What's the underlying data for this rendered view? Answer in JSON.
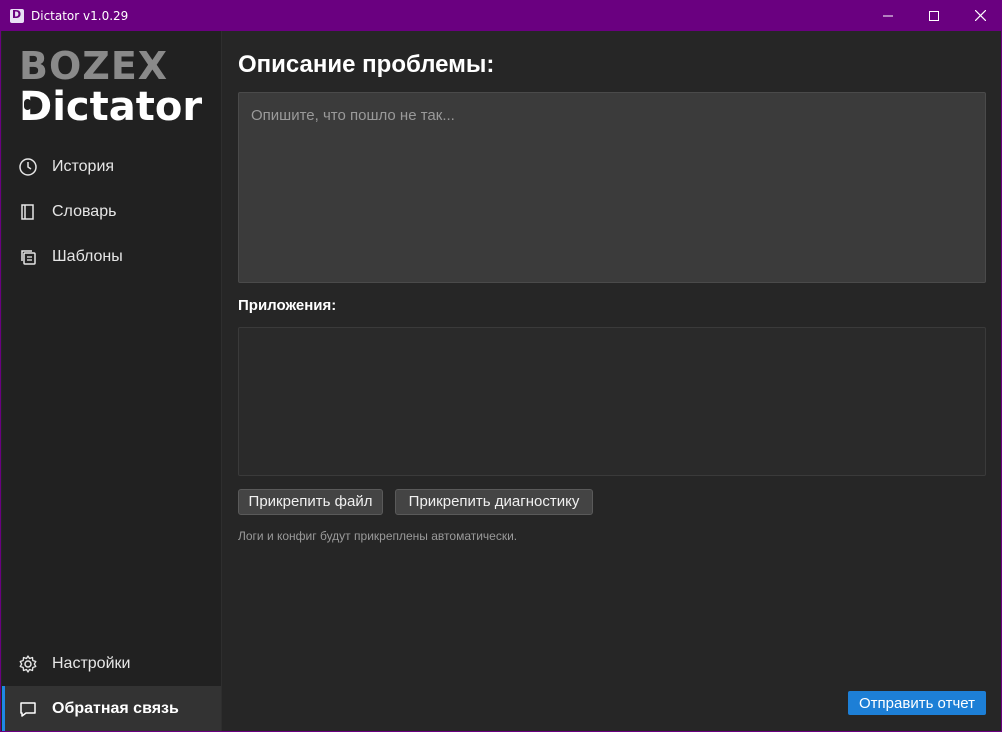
{
  "window": {
    "title": "Dictator v1.0.29",
    "accent_color": "#6a0080"
  },
  "sidebar": {
    "logo_top": "BOZEX",
    "logo_bottom": "Dictator",
    "items": [
      {
        "label": "История",
        "icon": "clock-icon"
      },
      {
        "label": "Словарь",
        "icon": "book-icon"
      },
      {
        "label": "Шаблоны",
        "icon": "templates-icon"
      }
    ],
    "bottom_items": [
      {
        "label": "Настройки",
        "icon": "gear-icon"
      },
      {
        "label": "Обратная связь",
        "icon": "chat-icon",
        "active": true
      }
    ]
  },
  "main": {
    "heading": "Описание проблемы:",
    "description_placeholder": "Опишите, что пошло не так...",
    "description_value": "",
    "attachments_label": "Приложения:",
    "attach_file_label": "Прикрепить файл",
    "attach_diagnostics_label": "Прикрепить диагностику",
    "hint": "Логи и конфиг будут прикреплены автоматически.",
    "send_label": "Отправить отчет",
    "send_color": "#1d7fd6"
  }
}
